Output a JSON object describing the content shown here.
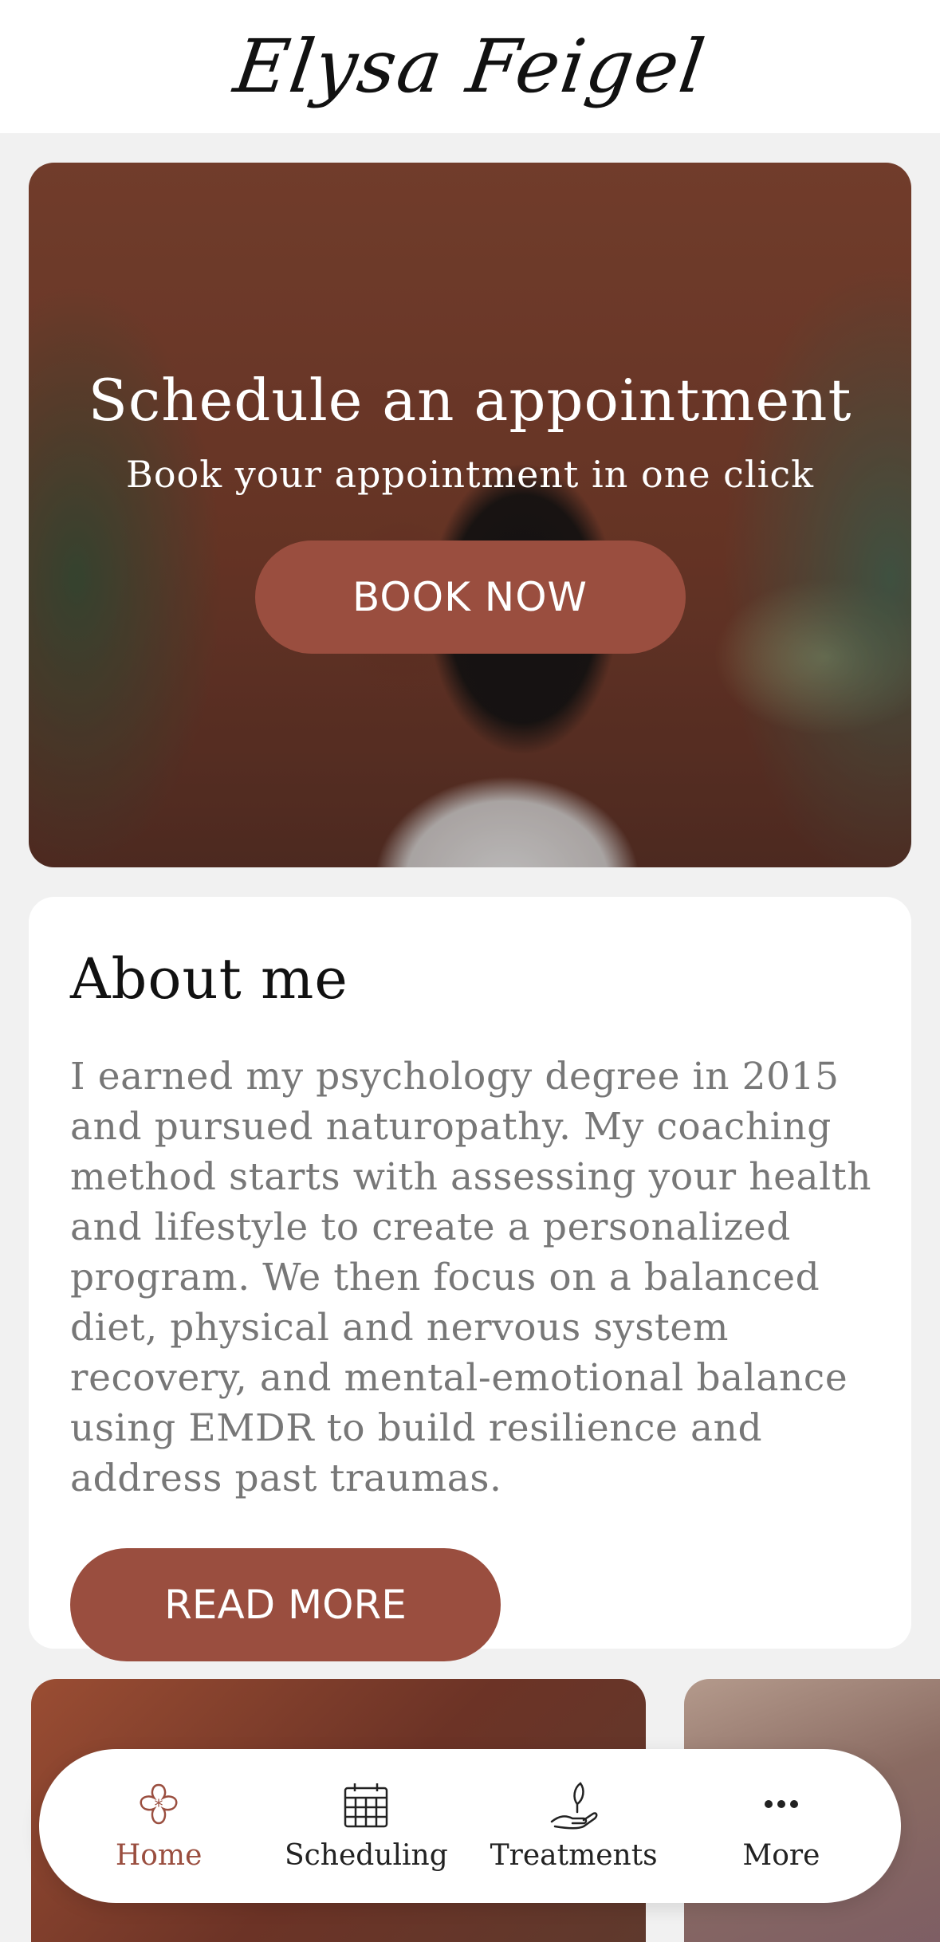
{
  "header": {
    "brand": "Elysa Feigel"
  },
  "hero": {
    "title": "Schedule an appointment",
    "subtitle": "Book your appointment in one click",
    "button_label": "BOOK NOW"
  },
  "about": {
    "title": "About me",
    "body": "I earned my psychology degree in 2015 and pursued naturopathy. My coaching method starts with assessing your health and lifestyle to create a personalized program. We then focus on a balanced diet, physical and nervous system recovery, and mental-emotional balance using EMDR to build resilience and address past traumas.",
    "button_label": "READ MORE"
  },
  "nav": {
    "items": [
      {
        "label": "Home",
        "icon": "flower-icon",
        "active": true
      },
      {
        "label": "Scheduling",
        "icon": "calendar-icon",
        "active": false
      },
      {
        "label": "Treatments",
        "icon": "hand-plant-icon",
        "active": false
      },
      {
        "label": "More",
        "icon": "more-dots-icon",
        "active": false
      }
    ]
  },
  "colors": {
    "accent": "#9a4e3f",
    "background": "#f1f1f1",
    "card": "#ffffff"
  }
}
